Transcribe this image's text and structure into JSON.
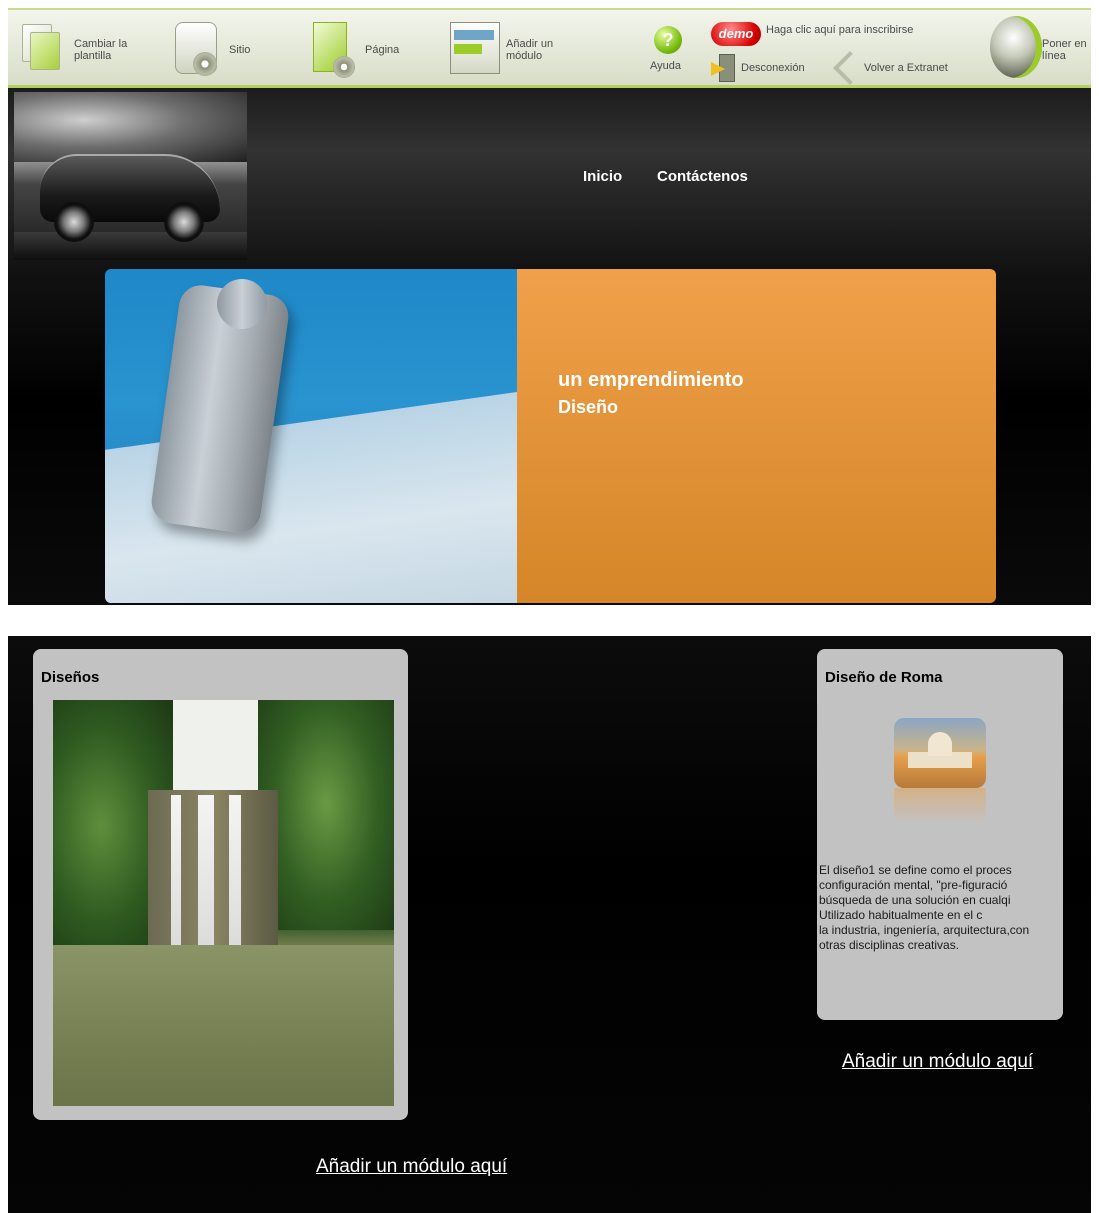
{
  "toolbar": {
    "change_template": "Cambiar la\nplantilla",
    "site": "Sitio",
    "page": "Página",
    "add_module": "Añadir un\nmódulo",
    "help": "Ayuda",
    "help_glyph": "?",
    "demo_badge": "demo",
    "signup": "Haga clic aquí para inscribirse",
    "logout": "Desconexión",
    "back_extranet": "Volver a Extranet",
    "publish": "Poner en\nlínea"
  },
  "header": {
    "nav": [
      "Inicio",
      "Contáctenos"
    ]
  },
  "banner": {
    "title": "un emprendimiento",
    "subtitle": "Diseño"
  },
  "content": {
    "left_box": {
      "title": "Diseños"
    },
    "right_box": {
      "title": "Diseño de Roma",
      "description_lines": [
        "El diseño1 se define como el proces",
        "configuración mental, \"pre-figuració",
        "búsqueda de una solución en cualqi",
        "Utilizado habitualmente en el c",
        "la industria, ingeniería, arquitectura,con",
        "otras disciplinas creativas."
      ]
    },
    "add_module_left": "Añadir un módulo aquí",
    "add_module_right": "Añadir un módulo aquí"
  },
  "colors": {
    "toolbar_accent": "#b4cf5c",
    "banner_orange": "#e6973e",
    "banner_blue": "#1e88c8",
    "box_gray": "#c2c2c2",
    "demo_red": "#d80000"
  },
  "icons": [
    "template-icon",
    "site-icon",
    "page-icon",
    "module-icon",
    "help-icon",
    "logout-icon",
    "extranet-icon",
    "publish-icon"
  ]
}
